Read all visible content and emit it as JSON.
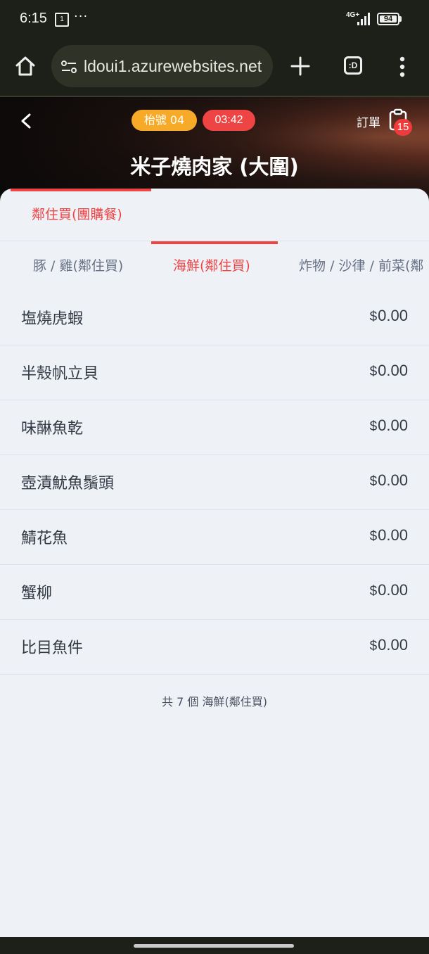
{
  "status_bar": {
    "time": "6:15",
    "notif_icon_text": "1",
    "dots": "···",
    "network": "4G+",
    "battery": "94"
  },
  "browser": {
    "url": "ldoui1.azurewebsites.net",
    "tabs_label": ":D"
  },
  "header": {
    "queue_badge": "枱號 04",
    "timer_badge": "03:42",
    "order_label": "訂單",
    "order_count": "15",
    "store_name": "米子燒肉家 (大圍)"
  },
  "categories": [
    {
      "label": "鄰住買(團購餐)",
      "active": true
    }
  ],
  "subcategories": [
    {
      "label": "豚 / 雞(鄰住買)",
      "active": false
    },
    {
      "label": "海鮮(鄰住買)",
      "active": true
    },
    {
      "label": "炸物 / 沙律 / 前菜(鄰",
      "active": false
    }
  ],
  "items": [
    {
      "name": "塩燒虎蝦",
      "currency": "$",
      "price": "0.00"
    },
    {
      "name": "半殼帆立貝",
      "currency": "$",
      "price": "0.00"
    },
    {
      "name": "味醂魚乾",
      "currency": "$",
      "price": "0.00"
    },
    {
      "name": "壺漬魷魚鬚頭",
      "currency": "$",
      "price": "0.00"
    },
    {
      "name": "鯖花魚",
      "currency": "$",
      "price": "0.00"
    },
    {
      "name": "蟹柳",
      "currency": "$",
      "price": "0.00"
    },
    {
      "name": "比目魚件",
      "currency": "$",
      "price": "0.00"
    }
  ],
  "footer": {
    "count_text": "共 7 個 海鮮(鄰住買)"
  },
  "colors": {
    "accent": "#ef4444",
    "queue_badge": "#f7a928",
    "sheet_bg": "#eef2f7"
  }
}
